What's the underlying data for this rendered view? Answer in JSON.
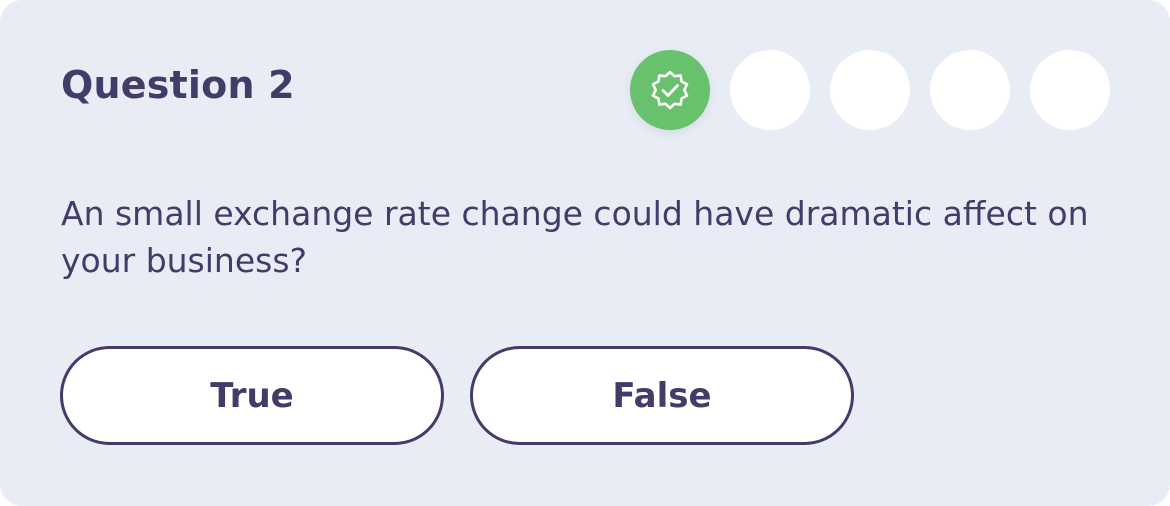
{
  "quiz": {
    "title": "Question 2",
    "question": "An small exchange rate change could have dramatic affect on your business?",
    "progress": [
      {
        "state": "completed",
        "icon": "verified-badge-icon"
      },
      {
        "state": "pending"
      },
      {
        "state": "pending"
      },
      {
        "state": "pending"
      },
      {
        "state": "pending"
      }
    ],
    "answers": [
      {
        "label": "True"
      },
      {
        "label": "False"
      }
    ],
    "colors": {
      "background": "#e8edf5",
      "text": "#433b68",
      "completed": "#67c16d",
      "pending": "#ffffff"
    }
  }
}
